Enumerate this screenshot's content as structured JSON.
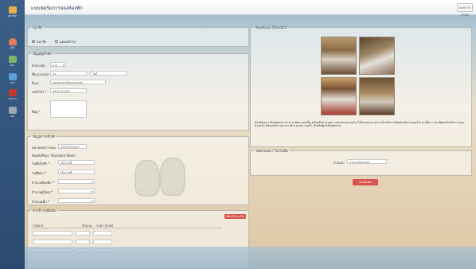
{
  "header": {
    "title": "แบบฟอร์มการจองห้องพัก",
    "logout_label": "ออกจากระบบ"
  },
  "sidebar": {
    "items": [
      {
        "label": "หน้าหลัก",
        "icon": "home-icon",
        "color": "#e8b04a"
      },
      {
        "label": "ผู้ใช้",
        "icon": "user-icon",
        "color": "#e67e5a"
      },
      {
        "label": "ห้อง",
        "icon": "room-icon",
        "color": "#7fb36a"
      },
      {
        "label": "จอง",
        "icon": "booking-icon",
        "color": "#5ba0d6"
      },
      {
        "label": "รายงาน",
        "icon": "report-icon",
        "color": "#c0392b"
      },
      {
        "label": "ออก",
        "icon": "exit-icon",
        "color": "#9aa9b8"
      }
    ]
  },
  "member": {
    "legend": "สมาชิก",
    "option_member": "สมาชิก",
    "option_general": "บุคคลทั่วไป"
  },
  "customer": {
    "legend": "ข้อมูลผู้เข้าพัก",
    "prefix_label": "คำนำหน้า",
    "prefix_value": "นาย",
    "name_label": "ชื่อ-นามสกุล *",
    "first_name": "สุข",
    "last_name": "ใจดี",
    "email_label": "อีเมล",
    "email_value": "songkran@gmail.com",
    "phone_label": "เบอร์โทร *",
    "phone_value": "0801234567",
    "address_label": "ที่อยู่ *"
  },
  "booking": {
    "legend": "ข้อมูลการเข้าพัก",
    "booking_id_label": "หมายเลขการจอง",
    "booking_id_value": "00000000007",
    "room_type_label": "ห้องพักที่จอง: Standard Room",
    "checkin_label": "วันที่เข้าพัก *",
    "checkin_value": "เลือกวันที่",
    "checkout_label": "วันที่ออก *",
    "checkout_value": "เลือกวันที่",
    "rooms_label": "จำนวนห้องพัก *",
    "adults_label": "จำนวนผู้ใหญ่ *",
    "children_label": "จำนวนเด็ก *"
  },
  "room_panel": {
    "legend": "ห้องพักแบบ Standard",
    "description": "ห้องพักแบบ Standard บรรยากาศสบายร่มรื่น พร้อมสิ่งอำนวยความสะดวกครบครัน ใกล้ชายหาด เหมาะสำหรับการพักผ่อนกับครอบครัวและเพื่อน ราคาพิเศษสำหรับการจองล่วงหน้า พร้อมบริการอาหารเช้าและสระว่ายน้ำ สำหรับผู้เข้าพักทุกท่าน"
  },
  "promo": {
    "legend": "รหัสส่วนลด / โปรโมชั่น",
    "label": "ส่วนลด:",
    "placeholder": "กรอกรหัสส่วนลด",
    "submit_label": "จองห้องพัก"
  },
  "extras": {
    "legend": "ค่าบริการเพิ่มเติม",
    "add_label": "เพิ่มบริการเสริม",
    "col_item": "รายการ",
    "col_qty": "จำนวน",
    "col_price": "ราคา (บาท)"
  }
}
